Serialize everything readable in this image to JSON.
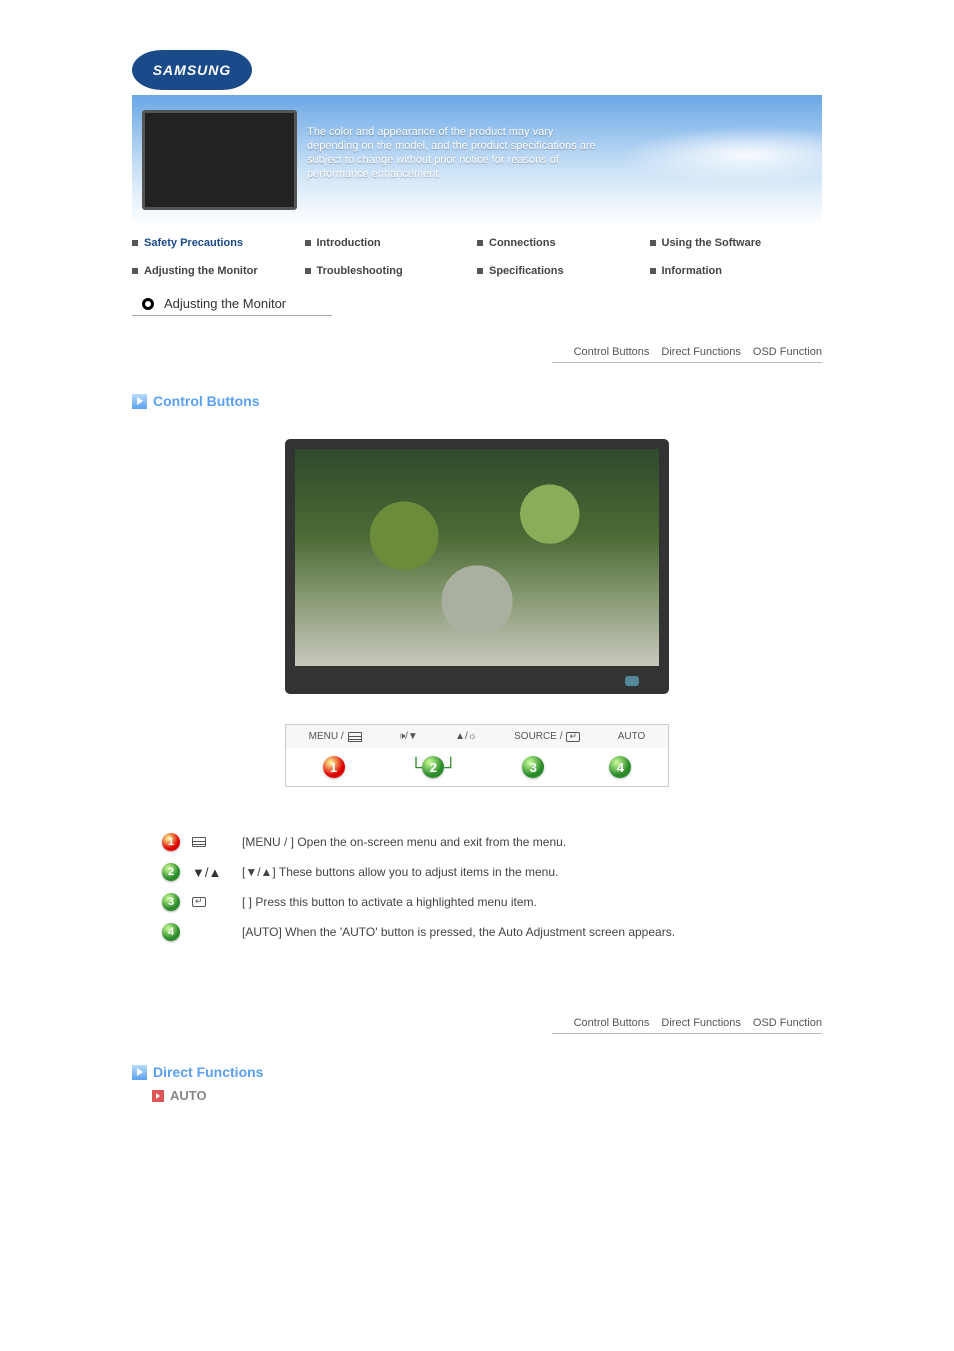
{
  "brand": "SAMSUNG",
  "banner_text": "The color and appearance of the product may vary depending on the model, and the product specifications are subject to change without prior notice for reasons of performance enhancement.",
  "nav_row1": [
    "Safety Precautions",
    "Introduction",
    "Connections",
    "Using the Software"
  ],
  "nav_row2": [
    "Adjusting the Monitor",
    "Troubleshooting",
    "Specifications",
    "Information"
  ],
  "section_title": "Adjusting the Monitor",
  "subnav": [
    "Control Buttons",
    "Direct Functions",
    "OSD Function"
  ],
  "section_heading_1": "Control Buttons",
  "strip": {
    "labels": [
      {
        "text_before": "MENU /",
        "glyph": "menu"
      },
      {
        "glyph": "vol-down",
        "text_after": ""
      },
      {
        "glyph": "up-sun",
        "text_after": ""
      },
      {
        "text_before": "SOURCE /",
        "glyph": "enter"
      },
      {
        "text_before": "AUTO"
      }
    ]
  },
  "legend": [
    {
      "num": "1",
      "glyph1": "",
      "glyph2": "menu",
      "desc": "[MENU / ] Open the on-screen menu and exit from the menu."
    },
    {
      "num": "2",
      "glyph1": "▼/▲",
      "glyph2": "",
      "desc": "[▼/▲] These buttons allow you to adjust items in the menu."
    },
    {
      "num": "3",
      "glyph1": "",
      "glyph2": "enter",
      "desc": "[ ] Press this button to activate a highlighted menu item."
    },
    {
      "num": "4",
      "glyph1": "",
      "glyph2": "",
      "desc": "[AUTO] When the 'AUTO' button is pressed, the Auto Adjustment screen appears."
    }
  ],
  "section_heading_2": "Direct Functions",
  "sub_heading": "AUTO"
}
